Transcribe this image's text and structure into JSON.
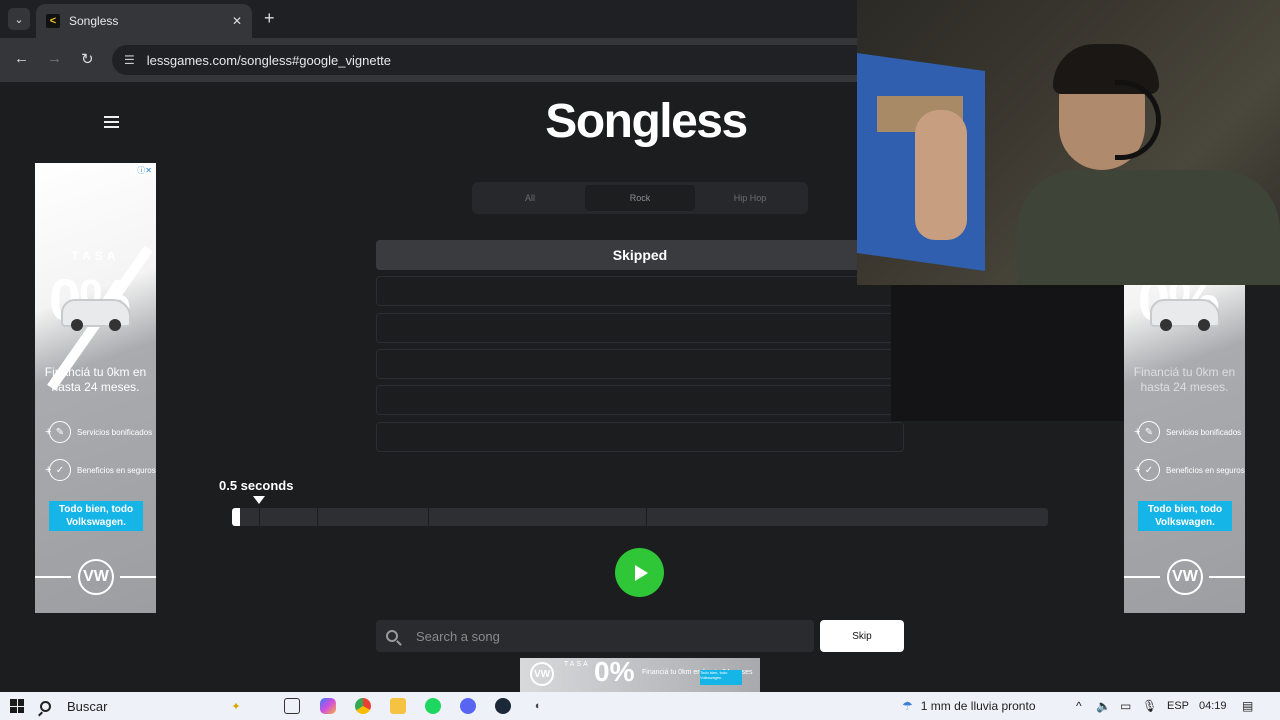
{
  "browser": {
    "tab_title": "Songless",
    "favicon_glyph": "<",
    "url": "lessgames.com/songless#google_vignette",
    "back": "←",
    "forward": "→",
    "reload": "↻",
    "new_tab": "+",
    "close_tab": "✕",
    "tab_menu": "⌄",
    "site_info": "☰"
  },
  "app": {
    "logo": "Songless",
    "genres": [
      {
        "label": "All",
        "active": false
      },
      {
        "label": "Rock",
        "active": true
      },
      {
        "label": "Hip Hop",
        "active": false
      }
    ],
    "guesses": [
      {
        "label": "Skipped",
        "state": "skipped"
      },
      {
        "label": "",
        "state": "empty"
      },
      {
        "label": "",
        "state": "empty"
      },
      {
        "label": "",
        "state": "empty"
      },
      {
        "label": "",
        "state": "empty"
      },
      {
        "label": "",
        "state": "empty"
      }
    ],
    "seconds_label": "0.5 seconds",
    "timeline_progress": 0.01,
    "search_placeholder": "Search a song",
    "skip_label": "Skip",
    "accent": "#2fc637"
  },
  "ads": {
    "tasa": "TASA",
    "percent": "0%",
    "headline": "Financiá tu 0km en hasta 24 meses.",
    "feature1": "Servicios bonificados",
    "feature2": "Beneficios en seguros",
    "cta": "Todo bien, todo Volkswagen.",
    "brand_glyph": "VW",
    "bottom_text": "Financiá tu 0km en hasta 24 meses",
    "bottom_cta": "Todo bien, todo Volkswagen."
  },
  "taskbar": {
    "search_label": "Buscar",
    "weather": "1 mm de lluvia pronto",
    "language": "ESP",
    "time": "04:19",
    "tray_up": "^"
  }
}
